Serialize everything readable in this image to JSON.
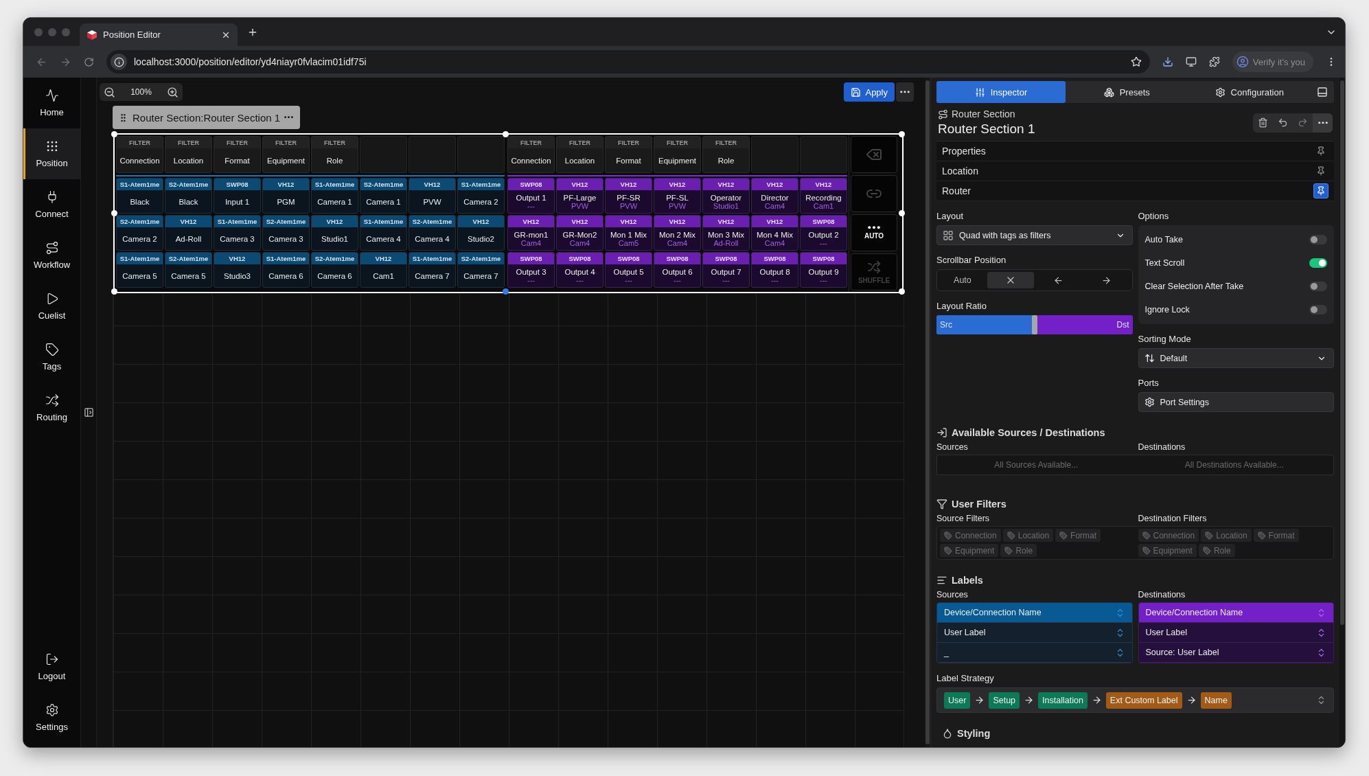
{
  "browser": {
    "tab_title": "Position Editor",
    "url": "localhost:3000/position/editor/yd4niayr0fvlacim01idf75i",
    "profile_label": "Verify it's you"
  },
  "nav": {
    "items": [
      {
        "label": "Home",
        "selected": false
      },
      {
        "label": "Position",
        "selected": true
      },
      {
        "label": "Connect",
        "selected": false
      },
      {
        "label": "Workflow",
        "selected": false
      },
      {
        "label": "Cuelist",
        "selected": false
      },
      {
        "label": "Tags",
        "selected": false
      },
      {
        "label": "Routing",
        "selected": false
      }
    ],
    "bottom_items": [
      {
        "label": "Logout"
      },
      {
        "label": "Settings"
      }
    ]
  },
  "canvas": {
    "zoom": "100%",
    "apply_label": "Apply",
    "section_label": "Router Section:Router Section 1"
  },
  "router": {
    "source_filters": [
      {
        "caption": "FILTER",
        "label": "Connection"
      },
      {
        "caption": "FILTER",
        "label": "Location"
      },
      {
        "caption": "FILTER",
        "label": "Format"
      },
      {
        "caption": "FILTER",
        "label": "Equipment"
      },
      {
        "caption": "FILTER",
        "label": "Role"
      }
    ],
    "sources": [
      [
        {
          "tag": "S1-Atem1me",
          "label": "Black"
        },
        {
          "tag": "S2-Atem1me",
          "label": "Black"
        },
        {
          "tag": "SWP08",
          "label": "Input 1"
        },
        {
          "tag": "VH12",
          "label": "PGM"
        },
        {
          "tag": "S1-Atem1me",
          "label": "Camera 1"
        },
        {
          "tag": "S2-Atem1me",
          "label": "Camera 1"
        },
        {
          "tag": "VH12",
          "label": "PVW"
        },
        {
          "tag": "S1-Atem1me",
          "label": "Camera 2"
        }
      ],
      [
        {
          "tag": "S2-Atem1me",
          "label": "Camera 2"
        },
        {
          "tag": "VH12",
          "label": "Ad-Roll"
        },
        {
          "tag": "S1-Atem1me",
          "label": "Camera 3"
        },
        {
          "tag": "S2-Atem1me",
          "label": "Camera 3"
        },
        {
          "tag": "VH12",
          "label": "Studio1"
        },
        {
          "tag": "S1-Atem1me",
          "label": "Camera 4"
        },
        {
          "tag": "S2-Atem1me",
          "label": "Camera 4"
        },
        {
          "tag": "VH12",
          "label": "Studio2"
        }
      ],
      [
        {
          "tag": "S1-Atem1me",
          "label": "Camera 5"
        },
        {
          "tag": "S2-Atem1me",
          "label": "Camera 5"
        },
        {
          "tag": "VH12",
          "label": "Studio3"
        },
        {
          "tag": "S1-Atem1me",
          "label": "Camera 6"
        },
        {
          "tag": "S2-Atem1me",
          "label": "Camera 6"
        },
        {
          "tag": "VH12",
          "label": "Cam1"
        },
        {
          "tag": "S1-Atem1me",
          "label": "Camera 7"
        },
        {
          "tag": "S2-Atem1me",
          "label": "Camera 7"
        }
      ]
    ],
    "destination_filters": [
      {
        "caption": "FILTER",
        "label": "Connection"
      },
      {
        "caption": "FILTER",
        "label": "Location"
      },
      {
        "caption": "FILTER",
        "label": "Format"
      },
      {
        "caption": "FILTER",
        "label": "Equipment"
      },
      {
        "caption": "FILTER",
        "label": "Role"
      }
    ],
    "destinations": [
      [
        {
          "tag": "SWP08",
          "label": "Output 1",
          "route": "---"
        },
        {
          "tag": "VH12",
          "label": "PF-Large",
          "route": "PVW"
        },
        {
          "tag": "VH12",
          "label": "PF-SR",
          "route": "PVW"
        },
        {
          "tag": "VH12",
          "label": "PF-SL",
          "route": "PVW"
        },
        {
          "tag": "VH12",
          "label": "Operator",
          "route": "Studio1"
        },
        {
          "tag": "VH12",
          "label": "Director",
          "route": "Cam4"
        },
        {
          "tag": "VH12",
          "label": "Recording",
          "route": "Cam1"
        }
      ],
      [
        {
          "tag": "VH12",
          "label": "GR-mon1",
          "route": "Cam4"
        },
        {
          "tag": "VH12",
          "label": "GR-Mon2",
          "route": "Cam4"
        },
        {
          "tag": "VH12",
          "label": "Mon 1 Mix",
          "route": "Cam5"
        },
        {
          "tag": "VH12",
          "label": "Mon 2 Mix",
          "route": "Cam4"
        },
        {
          "tag": "VH12",
          "label": "Mon 3 Mix",
          "route": "Ad-Roll"
        },
        {
          "tag": "VH12",
          "label": "Mon 4 Mix",
          "route": "Cam4"
        },
        {
          "tag": "SWP08",
          "label": "Output 2",
          "route": "---"
        }
      ],
      [
        {
          "tag": "SWP08",
          "label": "Output 3",
          "route": "---"
        },
        {
          "tag": "SWP08",
          "label": "Output 4",
          "route": "---"
        },
        {
          "tag": "SWP08",
          "label": "Output 5",
          "route": "---"
        },
        {
          "tag": "SWP08",
          "label": "Output 6",
          "route": "---"
        },
        {
          "tag": "SWP08",
          "label": "Output 7",
          "route": "---"
        },
        {
          "tag": "SWP08",
          "label": "Output 8",
          "route": "---"
        },
        {
          "tag": "SWP08",
          "label": "Output 9",
          "route": "---"
        }
      ]
    ],
    "actions": [
      {
        "kind": "clear",
        "disabled": true
      },
      {
        "kind": "link",
        "disabled": true
      },
      {
        "kind": "auto",
        "label": "AUTO",
        "disabled": false
      },
      {
        "kind": "shuffle",
        "label": "SHUFFLE",
        "disabled": true
      }
    ]
  },
  "inspector": {
    "tabs": [
      {
        "label": "Inspector",
        "selected": true
      },
      {
        "label": "Presets",
        "selected": false
      },
      {
        "label": "Configuration",
        "selected": false
      }
    ],
    "header": {
      "kind": "Router Section",
      "title": "Router Section 1"
    },
    "sections": [
      {
        "label": "Properties",
        "pinned": false
      },
      {
        "label": "Location",
        "pinned": false
      },
      {
        "label": "Router",
        "pinned": true
      }
    ],
    "layout": {
      "label": "Layout",
      "value": "Quad with tags as filters"
    },
    "scrollbar_position": {
      "label": "Scrollbar Position",
      "options": [
        {
          "kind": "text",
          "label": "Auto",
          "selected": false
        },
        {
          "kind": "none",
          "selected": true
        },
        {
          "kind": "left",
          "selected": false
        },
        {
          "kind": "right",
          "selected": false
        }
      ]
    },
    "layout_ratio": {
      "label": "Layout Ratio",
      "src_label": "Src",
      "dst_label": "Dst",
      "level": 0.5
    },
    "options": {
      "label": "Options",
      "items": [
        {
          "label": "Auto Take",
          "on": false
        },
        {
          "label": "Text Scroll",
          "on": true
        },
        {
          "label": "Clear Selection After Take",
          "on": false
        },
        {
          "label": "Ignore Lock",
          "on": false
        }
      ]
    },
    "sorting_mode": {
      "label": "Sorting Mode",
      "value": "Default"
    },
    "ports": {
      "label": "Ports",
      "button": "Port Settings"
    },
    "available": {
      "title": "Available Sources / Destinations",
      "sources_label": "Sources",
      "destinations_label": "Destinations",
      "sources_placeholder": "All Sources Available...",
      "destinations_placeholder": "All Destinations Available..."
    },
    "user_filters": {
      "title": "User Filters",
      "source_label": "Source Filters",
      "destination_label": "Destination Filters",
      "source_tags": [
        "Connection",
        "Location",
        "Format",
        "Equipment",
        "Role"
      ],
      "destination_tags": [
        "Connection",
        "Location",
        "Format",
        "Equipment",
        "Role"
      ]
    },
    "labels": {
      "title": "Labels",
      "sources_label": "Sources",
      "destinations_label": "Destinations",
      "sources": [
        {
          "label": "Device/Connection Name",
          "selected": true
        },
        {
          "label": "User Label",
          "selected": false
        },
        {
          "label": "_",
          "selected": false
        }
      ],
      "destinations": [
        {
          "label": "Device/Connection Name",
          "selected": true
        },
        {
          "label": "User Label",
          "selected": false
        },
        {
          "label": "Source: User Label",
          "selected": false
        }
      ]
    },
    "label_strategy": {
      "label": "Label Strategy",
      "steps": [
        {
          "label": "User",
          "color": "#0b7a55"
        },
        {
          "label": "Setup",
          "color": "#0b7a55"
        },
        {
          "label": "Installation",
          "color": "#0b7a55"
        },
        {
          "label": "Ext Custom Label",
          "color": "#a35a14"
        },
        {
          "label": "Name",
          "color": "#a35a14"
        }
      ]
    },
    "styling": {
      "title": "Styling"
    }
  }
}
